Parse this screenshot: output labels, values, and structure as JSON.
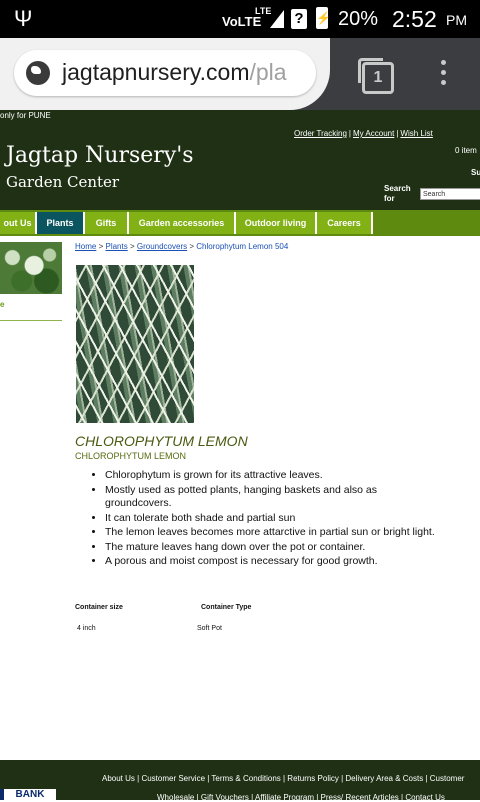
{
  "status_bar": {
    "usb_icon": "usb-icon",
    "network": "VoLTE",
    "lte": "LTE",
    "unknown_sim": "?",
    "battery_percent": "20%",
    "time": "2:52",
    "ampm": "PM"
  },
  "browser": {
    "url_main": "jagtapnursery.com",
    "url_path": "/pla",
    "tab_count": "1"
  },
  "header": {
    "notice": "only for PUNE",
    "links": [
      "Order Tracking",
      "My Account",
      "Wish List"
    ],
    "cart": "0 item",
    "logo_line1": "Jagtap Nursery's",
    "logo_line2": "Garden Center",
    "su": "Su",
    "search_label": "Search for",
    "search_value": "Search"
  },
  "nav": {
    "items": [
      "out Us",
      "Plants",
      "Gifts",
      "Garden accessories",
      "Outdoor living",
      "Careers"
    ],
    "active_index": 1
  },
  "sidebar": {
    "label": "e"
  },
  "breadcrumb": {
    "home": "Home",
    "plants": "Plants",
    "groundcovers": "Groundcovers",
    "current": "Chlorophytum Lemon 504",
    "separator": ">"
  },
  "product": {
    "title": "CHLOROPHYTUM LEMON",
    "subtitle": "CHLOROPHYTUM LEMON",
    "bullets": [
      "Chlorophytum is grown for its attractive leaves.",
      "Mostly used as potted plants, hanging baskets and also as groundcovers.",
      "It can tolerate both shade and partial sun",
      "The lemon leaves becomes more attarctive in partial sun or bright light.",
      "The mature leaves hang down over the pot or container.",
      "A porous and moist compost is necessary for good growth."
    ],
    "spec_headers": [
      "Container size",
      "Container Type"
    ],
    "spec_values": [
      "4 inch",
      "Soft Pot"
    ]
  },
  "footer": {
    "row1": [
      "About Us",
      "Customer Service",
      "Terms & Conditions",
      "Returns Policy",
      "Delivery Area & Costs",
      "Customer"
    ],
    "row2": [
      "Wholesale",
      "Gift Vouchers",
      "Affiliate Program",
      "Press/ Recent Articles",
      "Contact Us"
    ],
    "bank": "BANK"
  },
  "colors": {
    "header_bg": "#1f3014",
    "nav_bg": "#82b116",
    "nav_active": "#0b5560",
    "link": "#1a4fb5",
    "title": "#4a5a10"
  }
}
